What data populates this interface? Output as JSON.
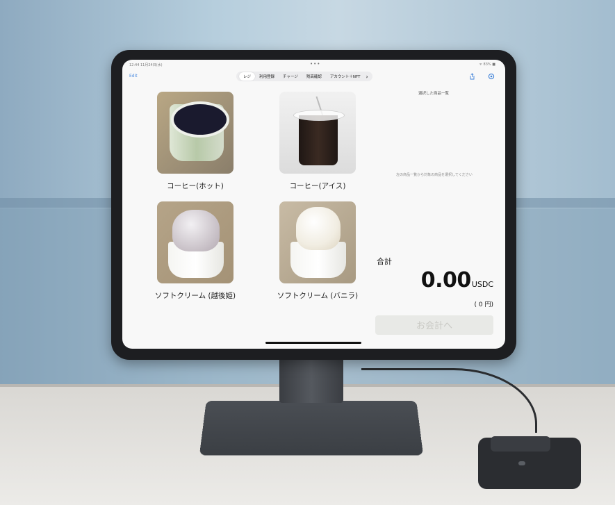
{
  "status_bar": {
    "time": "12:44 11月24日(水)",
    "dots": "•••",
    "battery": "ᯤ 83% ■"
  },
  "toolbar": {
    "edit_label": "Edit",
    "tabs": [
      {
        "label": "レジ",
        "active": true
      },
      {
        "label": "利用登録",
        "active": false
      },
      {
        "label": "チャージ",
        "active": false
      },
      {
        "label": "残高確認",
        "active": false
      },
      {
        "label": "アカウント＋NFT",
        "active": false
      }
    ],
    "next_glyph": "›",
    "share_icon": "share-icon",
    "settings_icon": "gear-icon"
  },
  "products": [
    {
      "name": "コーヒー(ホット)",
      "photo": "hot-coffee"
    },
    {
      "name": "コーヒー(アイス)",
      "photo": "iced-coffee"
    },
    {
      "name": "ソフトクリーム (越後姫)",
      "photo": "soft-serve-strawberry"
    },
    {
      "name": "ソフトクリーム (バニラ)",
      "photo": "soft-serve-vanilla"
    }
  ],
  "selection": {
    "title": "選択した商品一覧",
    "empty_hint": "左の商品一覧から対象の商品を選択してください"
  },
  "total": {
    "label": "合計",
    "amount": "0.00",
    "currency": "USDC",
    "jpy": "( 0 円)"
  },
  "checkout": {
    "label": "お会計へ",
    "enabled": false
  },
  "colors": {
    "accent": "#3b7fd8",
    "disabled_button": "#e8e9e6",
    "disabled_text": "#c9c9c4"
  }
}
